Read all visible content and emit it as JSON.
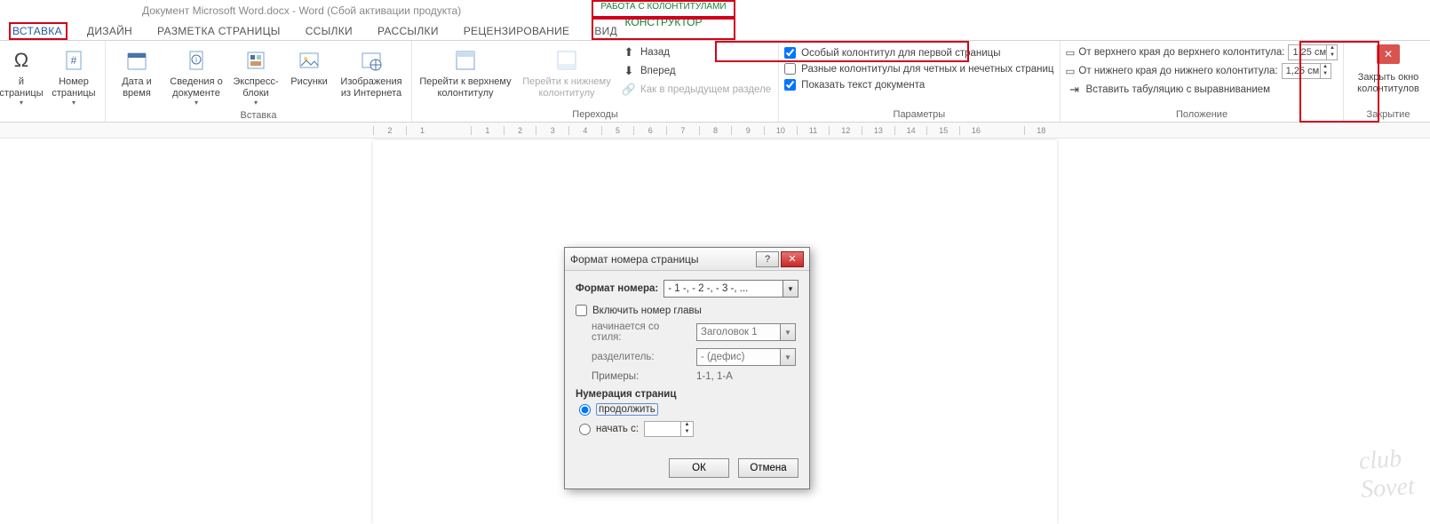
{
  "titlebar": "Документ Microsoft Word.docx - Word (Сбой активации продукта)",
  "tabs": {
    "insert": "ВСТАВКА",
    "design": "ДИЗАЙН",
    "layout": "РАЗМЕТКА СТРАНИЦЫ",
    "references": "ССЫЛКИ",
    "mailings": "РАССЫЛКИ",
    "review": "РЕЦЕНЗИРОВАНИЕ",
    "view": "ВИД",
    "contextual_title": "РАБОТА С КОЛОНТИТУЛАМИ",
    "contextual_tab": "КОНСТРУКТОР"
  },
  "ribbon": {
    "hf_partial": "й\nстраницы",
    "page_number": "Номер\nстраницы",
    "date_time": "Дата и\nвремя",
    "doc_info": "Сведения о\nдокументе",
    "quick_parts": "Экспресс-\nблоки",
    "pictures": "Рисунки",
    "online_pictures": "Изображения\nиз Интернета",
    "group_insert": "Вставка",
    "goto_header": "Перейти к верхнему\nколонтитулу",
    "goto_footer": "Перейти к нижнему\nколонтитулу",
    "nav_back": "Назад",
    "nav_forward": "Вперед",
    "nav_prev_section": "Как в предыдущем разделе",
    "group_nav": "Переходы",
    "opt_first": "Особый колонтитул для первой страницы",
    "opt_odd_even": "Разные колонтитулы для четных и нечетных страниц",
    "opt_show_doc": "Показать текст документа",
    "group_options": "Параметры",
    "pos_top": "От верхнего края до верхнего колонтитула:",
    "pos_bottom": "От нижнего края до нижнего колонтитула:",
    "pos_top_val": "1,25 см",
    "pos_bottom_val": "1,25 см",
    "pos_tab": "Вставить табуляцию с выравниванием",
    "group_pos": "Положение",
    "close_hf": "Закрыть окно\nколонтитулов",
    "group_close": "Закрытие"
  },
  "ruler": [
    "2",
    "1",
    "",
    "1",
    "2",
    "3",
    "4",
    "5",
    "6",
    "7",
    "8",
    "9",
    "10",
    "11",
    "12",
    "13",
    "14",
    "15",
    "16",
    "",
    "18"
  ],
  "dialog": {
    "title": "Формат номера страницы",
    "number_format_label": "Формат номера:",
    "number_format_value": "- 1 -, - 2 -, - 3 -, ...",
    "include_chapter": "Включить номер главы",
    "starts_with_style": "начинается со стиля:",
    "style_value": "Заголовок 1",
    "separator_label": "разделитель:",
    "separator_value": "-      (дефис)",
    "examples_label": "Примеры:",
    "examples_value": "1-1, 1-А",
    "numbering_label": "Нумерация страниц",
    "continue": "продолжить",
    "start_at": "начать с:",
    "ok": "ОК",
    "cancel": "Отмена"
  },
  "watermark": "club\nSovet"
}
